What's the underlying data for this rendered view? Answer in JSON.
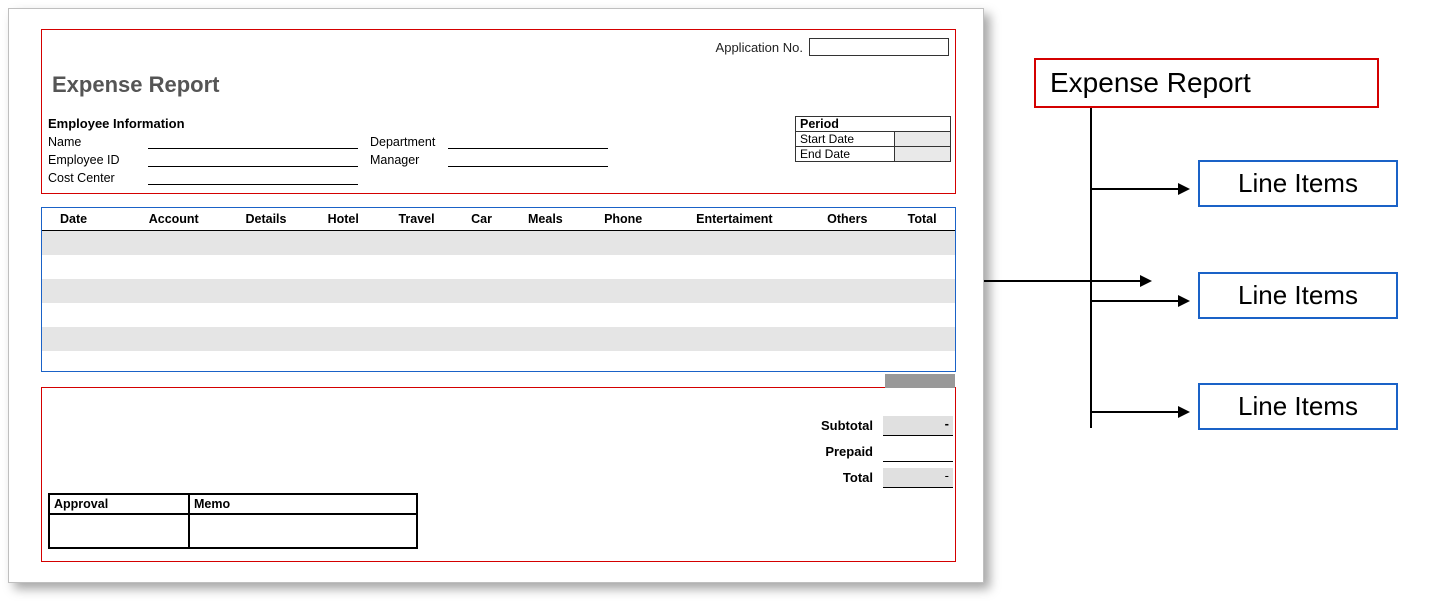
{
  "form": {
    "application_no_label": "Application No.",
    "title": "Expense Report",
    "employee_section": "Employee Information",
    "fields": {
      "name": "Name",
      "employee_id": "Employee ID",
      "cost_center": "Cost Center",
      "department": "Department",
      "manager": "Manager"
    },
    "period": {
      "heading": "Period",
      "start": "Start Date",
      "end": "End Date"
    },
    "columns": [
      "Date",
      "Account",
      "Details",
      "Hotel",
      "Travel",
      "Car",
      "Meals",
      "Phone",
      "Entertaiment",
      "Others",
      "Total"
    ],
    "totals": {
      "subtotal": "Subtotal",
      "prepaid": "Prepaid",
      "total": "Total"
    },
    "approval": {
      "approval": "Approval",
      "memo": "Memo"
    }
  },
  "diagram": {
    "header": "Expense Report",
    "items": [
      "Line Items",
      "Line Items",
      "Line Items"
    ]
  }
}
